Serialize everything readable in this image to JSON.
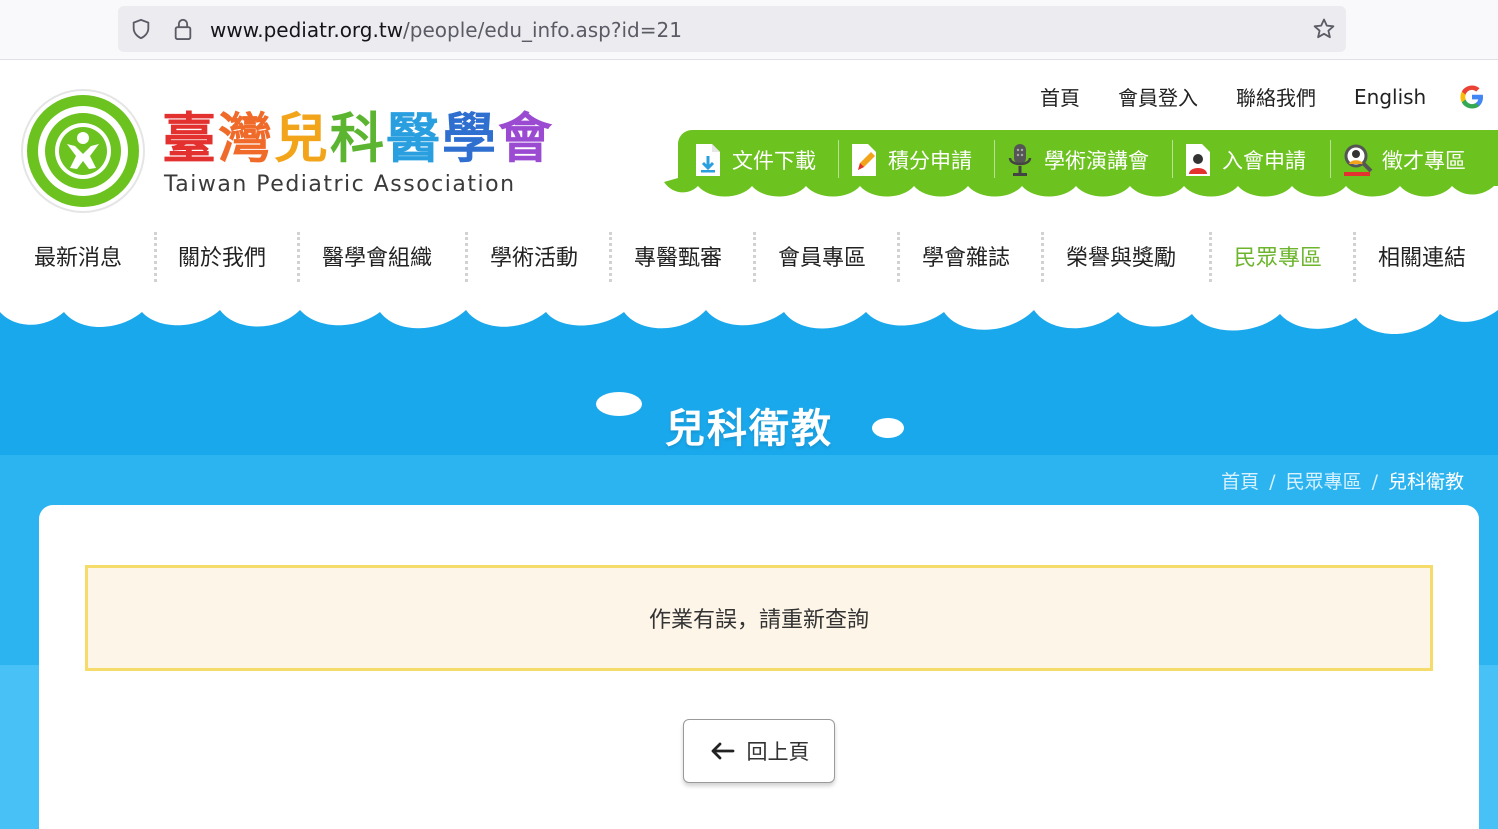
{
  "browser": {
    "url_host": "www.pediatr.org.tw",
    "url_path": "/people/edu_info.asp?id=21"
  },
  "header": {
    "logo_zh_chars": [
      "臺",
      "灣",
      "兒",
      "科",
      "醫",
      "學",
      "會"
    ],
    "logo_zh_colors": [
      "#e2312f",
      "#f06a2a",
      "#f2a51a",
      "#5cb531",
      "#2a9fe0",
      "#2f6fd0",
      "#9b4bd1"
    ],
    "logo_en": "Taiwan Pediatric Association",
    "top_links": [
      "首頁",
      "會員登入",
      "聯絡我們",
      "English"
    ],
    "quick_links": [
      "文件下載",
      "積分申請",
      "學術演講會",
      "入會申請",
      "徵才專區"
    ]
  },
  "nav": {
    "items": [
      "最新消息",
      "關於我們",
      "醫學會組織",
      "學術活動",
      "專醫甄審",
      "會員專區",
      "學會雜誌",
      "榮譽與獎勵",
      "民眾專區",
      "相關連結"
    ],
    "active": "民眾專區"
  },
  "banner": {
    "title": "兒科衛教"
  },
  "breadcrumb": {
    "items": [
      "首頁",
      "民眾專區",
      "兒科衛教"
    ],
    "separator": "/"
  },
  "content": {
    "message": "作業有誤，請重新查詢",
    "back_button": "回上頁"
  },
  "colors": {
    "green": "#6cc21f",
    "blue_banner": "#1aa8ec",
    "blue_band": "#2bb4f0",
    "alert_bg": "#fdf5e8",
    "alert_border": "#f5dc6a",
    "nav_active": "#6cb52d"
  }
}
